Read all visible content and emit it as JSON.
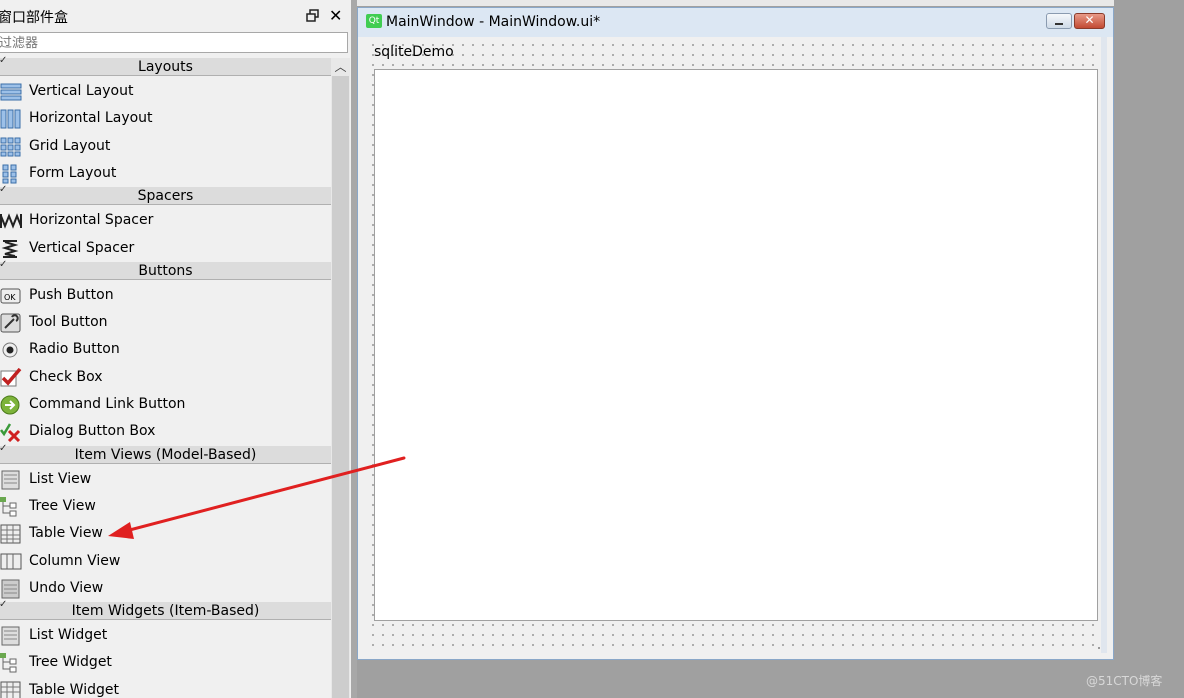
{
  "dock": {
    "title": "窗口部件盒",
    "close_glyph": "✕",
    "filter_placeholder": "过滤器"
  },
  "widget_box": {
    "categories": [
      {
        "label": "Layouts",
        "items": [
          "Vertical Layout",
          "Horizontal Layout",
          "Grid Layout",
          "Form Layout"
        ]
      },
      {
        "label": "Spacers",
        "items": [
          "Horizontal Spacer",
          "Vertical Spacer"
        ]
      },
      {
        "label": "Buttons",
        "items": [
          "Push Button",
          "Tool Button",
          "Radio Button",
          "Check Box",
          "Command Link Button",
          "Dialog Button Box"
        ]
      },
      {
        "label": "Item Views (Model-Based)",
        "items": [
          "List View",
          "Tree View",
          "Table View",
          "Column View",
          "Undo View"
        ]
      },
      {
        "label": "Item Widgets (Item-Based)",
        "items": [
          "List Widget",
          "Tree Widget",
          "Table Widget"
        ]
      }
    ],
    "icons": {
      "Vertical Layout": "vertical-layout-icon",
      "Horizontal Layout": "horizontal-layout-icon",
      "Grid Layout": "grid-layout-icon",
      "Form Layout": "form-layout-icon",
      "Horizontal Spacer": "horizontal-spacer-icon",
      "Vertical Spacer": "vertical-spacer-icon",
      "Push Button": "push-button-icon",
      "Tool Button": "tool-button-icon",
      "Radio Button": "radio-button-icon",
      "Check Box": "check-box-icon",
      "Command Link Button": "command-link-icon",
      "Dialog Button Box": "dialog-button-box-icon",
      "List View": "list-view-icon",
      "Tree View": "tree-view-icon",
      "Table View": "table-view-icon",
      "Column View": "column-view-icon",
      "Undo View": "undo-view-icon",
      "List Widget": "list-widget-icon",
      "Tree Widget": "tree-widget-icon",
      "Table Widget": "table-widget-icon"
    },
    "highlighted_item": "Table View"
  },
  "form_window": {
    "title": "MainWindow - MainWindow.ui*",
    "qt_badge": "Qt",
    "menu_label": "sqliteDemo",
    "close_glyph": "✕"
  },
  "watermark": "@51CTO博客",
  "colors": {
    "arrow": "#e02020",
    "category_bg": "#dcdcdc",
    "titlebar_bg": "#dce7f3",
    "qt_green": "#41cd52"
  }
}
